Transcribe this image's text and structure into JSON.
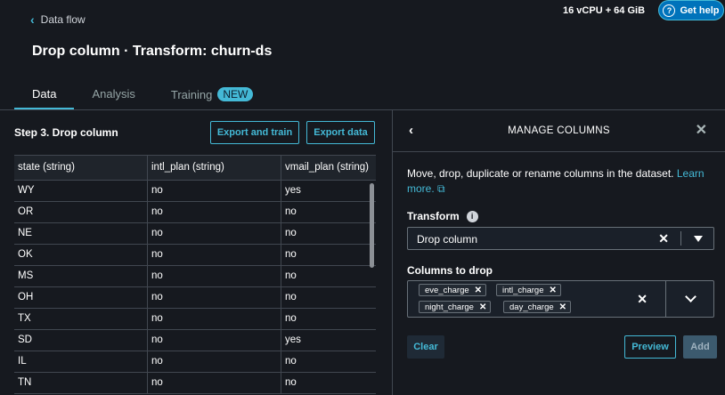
{
  "header": {
    "back_label": "Data flow",
    "resources": "16 vCPU + 64 GiB",
    "help_label": "Get help",
    "page_title": "Drop column · Transform: churn-ds"
  },
  "tabs": [
    {
      "label": "Data",
      "active": true
    },
    {
      "label": "Analysis",
      "active": false
    },
    {
      "label": "Training",
      "active": false,
      "badge": "NEW"
    }
  ],
  "left_panel": {
    "step_title": "Step 3. Drop column",
    "export_train_label": "Export and train",
    "export_data_label": "Export data",
    "columns": [
      "state (string)",
      "intl_plan (string)",
      "vmail_plan (string)"
    ],
    "rows": [
      [
        "WY",
        "no",
        "yes"
      ],
      [
        "OR",
        "no",
        "no"
      ],
      [
        "NE",
        "no",
        "no"
      ],
      [
        "OK",
        "no",
        "no"
      ],
      [
        "MS",
        "no",
        "no"
      ],
      [
        "OH",
        "no",
        "no"
      ],
      [
        "TX",
        "no",
        "no"
      ],
      [
        "SD",
        "no",
        "yes"
      ],
      [
        "IL",
        "no",
        "no"
      ],
      [
        "TN",
        "no",
        "no"
      ]
    ]
  },
  "right_panel": {
    "title": "MANAGE COLUMNS",
    "description": "Move, drop, duplicate or rename columns in the dataset.",
    "learn_more": "Learn more.",
    "transform_label": "Transform",
    "transform_value": "Drop column",
    "columns_label": "Columns to drop",
    "chips": [
      "eve_charge",
      "intl_charge",
      "night_charge",
      "day_charge"
    ],
    "clear_label": "Clear",
    "preview_label": "Preview",
    "add_label": "Add"
  },
  "colors": {
    "accent": "#44b9d6",
    "background": "#16191f",
    "help_button": "#0073bb"
  }
}
